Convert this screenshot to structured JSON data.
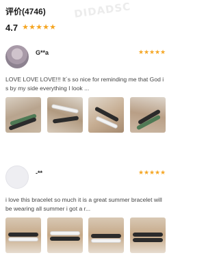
{
  "header": {
    "title": "评价(4746)",
    "average_rating": "4.7",
    "star_glyph": "★",
    "star_color": "#f5a623"
  },
  "watermark": "DIDADSC",
  "reviews": [
    {
      "user": "G**a",
      "stars": 5,
      "avatar": "user-photo",
      "text": "LOVE LOVE LOVE!!! It´s so nice for reminding me that God is by my side everything I look ...",
      "photo_count": 4
    },
    {
      "user": "-**",
      "stars": 5,
      "avatar": "blank-avatar",
      "text": "i love this bracelet so much it is a great summer bracelet will be wearing all summer i got a r...",
      "photo_count": 4
    }
  ]
}
